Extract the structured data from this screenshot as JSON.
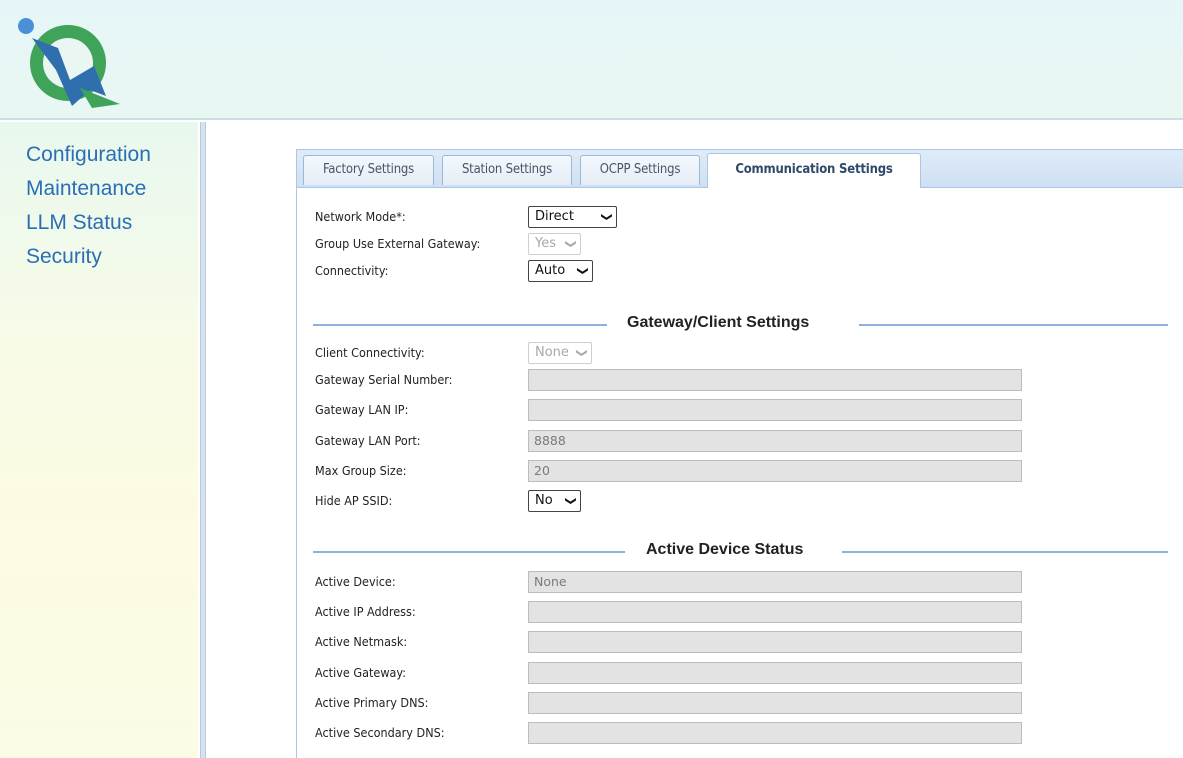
{
  "sidebar": {
    "items": [
      {
        "label": "Configuration"
      },
      {
        "label": "Maintenance"
      },
      {
        "label": "LLM Status"
      },
      {
        "label": "Security"
      }
    ]
  },
  "tabs": [
    {
      "label": "Factory Settings"
    },
    {
      "label": "Station Settings"
    },
    {
      "label": "OCPP Settings"
    },
    {
      "label": "Communication Settings",
      "active": true
    }
  ],
  "network": {
    "mode_label": "Network Mode*:",
    "mode_value": "Direct",
    "group_gateway_label": "Group Use External Gateway:",
    "group_gateway_value": "Yes",
    "connectivity_label": "Connectivity:",
    "connectivity_value": "Auto"
  },
  "gateway_section": {
    "title": "Gateway/Client Settings",
    "client_connectivity_label": "Client Connectivity:",
    "client_connectivity_value": "None",
    "serial_label": "Gateway Serial Number:",
    "serial_value": "",
    "lan_ip_label": "Gateway LAN IP:",
    "lan_ip_value": "",
    "lan_port_label": "Gateway LAN Port:",
    "lan_port_value": "8888",
    "max_group_label": "Max Group Size:",
    "max_group_value": "20",
    "hide_ssid_label": "Hide AP SSID:",
    "hide_ssid_value": "No"
  },
  "active_section": {
    "title": "Active Device Status",
    "device_label": "Active Device:",
    "device_value": "None",
    "ip_label": "Active IP Address:",
    "ip_value": "",
    "netmask_label": "Active Netmask:",
    "netmask_value": "",
    "gateway_label": "Active Gateway:",
    "gateway_value": "",
    "dns1_label": "Active Primary DNS:",
    "dns1_value": "",
    "dns2_label": "Active Secondary DNS:",
    "dns2_value": ""
  },
  "colors": {
    "nav_link": "#2a6fb3",
    "logo_green": "#3fa35a",
    "logo_blue": "#2f6fae",
    "section_rule": "#8fb2dc"
  }
}
